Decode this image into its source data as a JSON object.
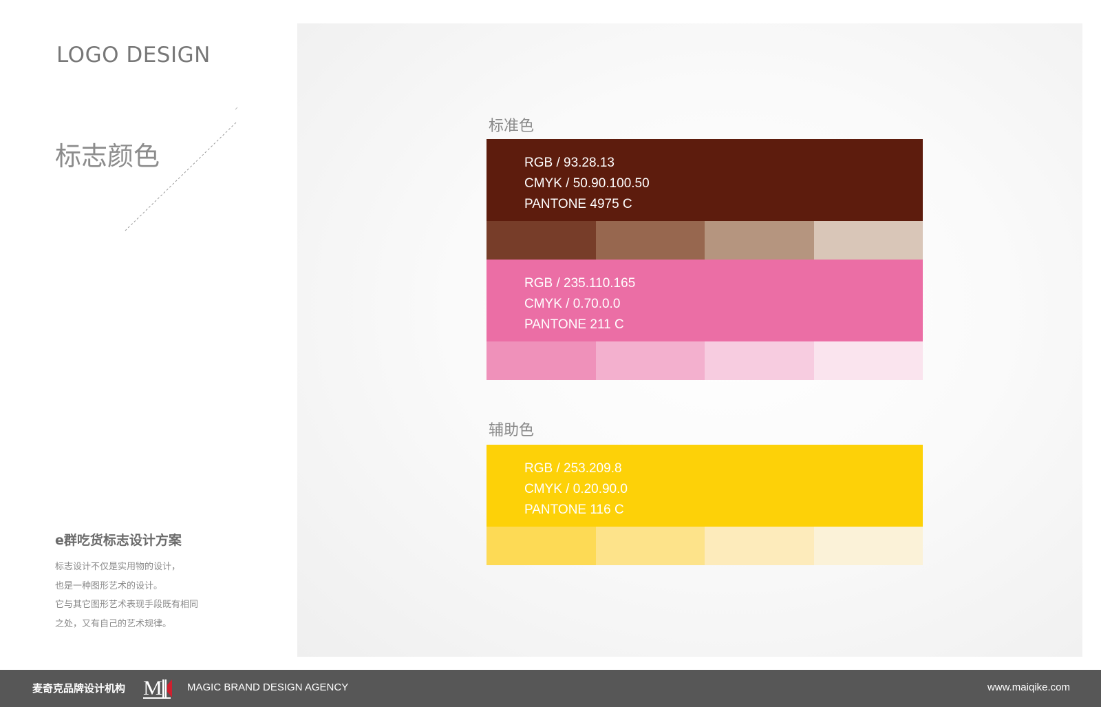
{
  "header": {
    "title": "LOGO DESIGN"
  },
  "section": {
    "title": "标志颜色"
  },
  "project": {
    "title": "e群吃货标志设计方案",
    "description": [
      "标志设计不仅是实用物的设计，",
      "也是一种图形艺术的设计。",
      "它与其它图形艺术表现手段既有相同",
      "之处，又有自己的艺术规律。"
    ]
  },
  "standard": {
    "label": "标准色",
    "colors": [
      {
        "color": "#5D1C0D",
        "rgb": "RGB / 93.28.13",
        "cmyk": "CMYK / 50.90.100.50",
        "pantone": "PANTONE 4975 C",
        "tints": [
          "#773D29",
          "#97674F",
          "#B5957F",
          "#D9C6B8"
        ]
      },
      {
        "color": "#EB6EA5",
        "rgb": "RGB / 235.110.165",
        "cmyk": "CMYK / 0.70.0.0",
        "pantone": "PANTONE 211 C",
        "tints": [
          "#EF91BA",
          "#F3B0CE",
          "#F7CCE0",
          "#FAE4EE"
        ]
      }
    ]
  },
  "auxiliary": {
    "label": "辅助色",
    "colors": [
      {
        "color": "#FDD108",
        "rgb": "RGB / 253.209.8",
        "cmyk": "CMYK / 0.20.90.0",
        "pantone": "PANTONE 116 C",
        "tints": [
          "#FDDA55",
          "#FDE38A",
          "#FDEBBB",
          "#FBF2D8"
        ]
      }
    ]
  },
  "footer": {
    "company_cn": "麦奇克品牌设计机构",
    "logo_text": "MIK",
    "company_en": "MAGIC BRAND DESIGN AGENCY",
    "url": "www.maiqike.com"
  }
}
